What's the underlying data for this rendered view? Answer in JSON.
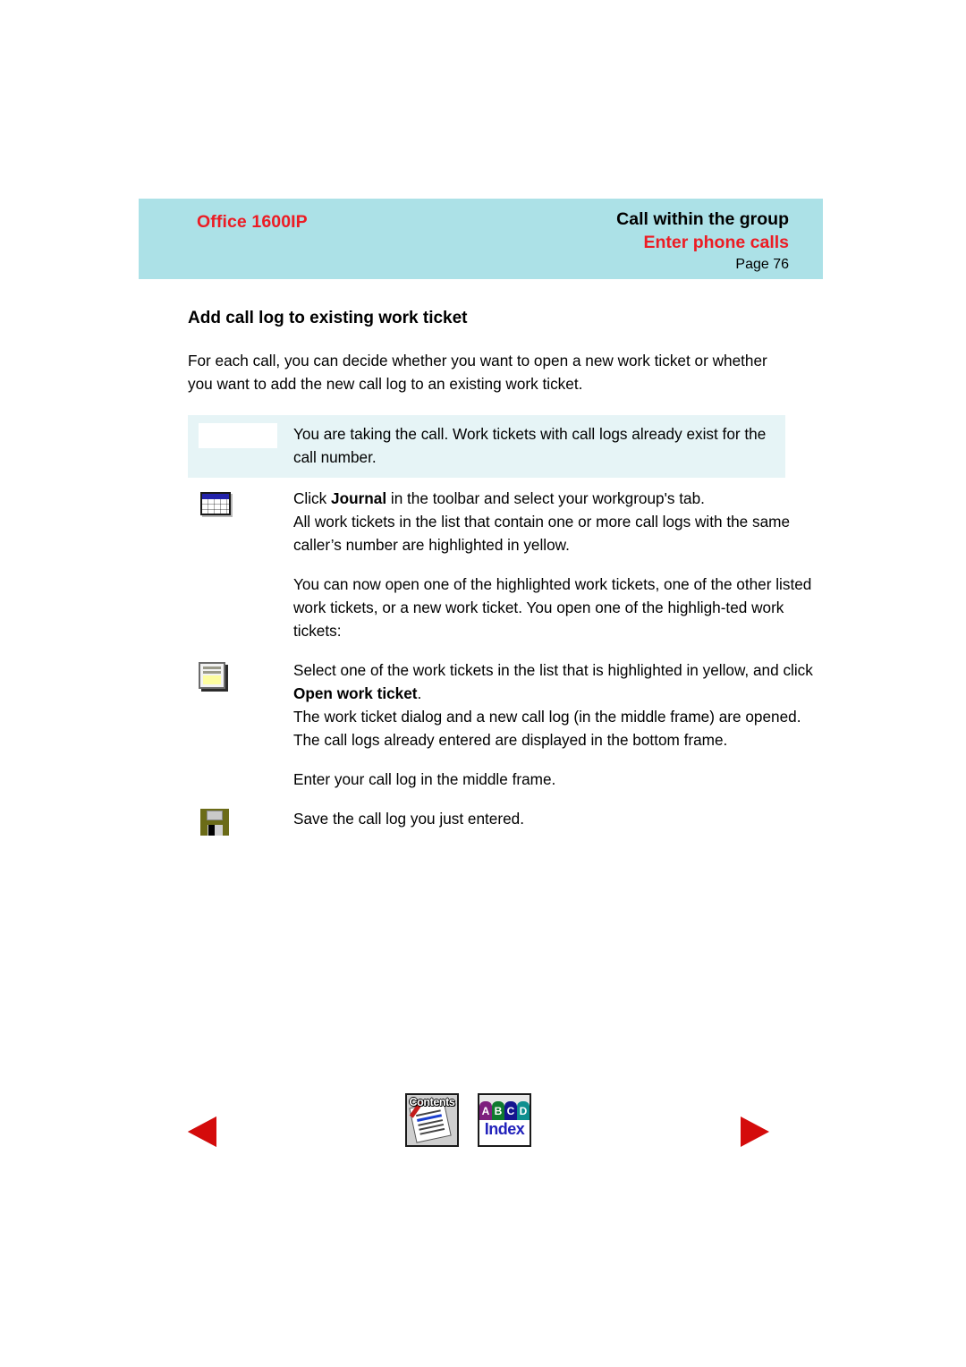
{
  "header": {
    "product": "Office 1600IP",
    "section": "Call within the group",
    "subsection": "Enter phone calls",
    "page_label": "Page 76",
    "band_color": "#ace1e7",
    "accent_color": "#ec1c24"
  },
  "content": {
    "section_title": "Add call log to existing work ticket",
    "intro": "For each call, you can decide whether you want to open a new work ticket or whether you want to add the new call log to an existing work ticket.",
    "note": {
      "text": "You are taking the call. Work tickets with call logs already exist for the call number.",
      "background": "#e6f4f6"
    },
    "steps": [
      {
        "icon": "journal-icon",
        "lines": [
          "Click ",
          "Journal",
          " in the toolbar and select your workgroup's tab."
        ],
        "line_plain": "Click Journal in the toolbar and select your workgroup's tab.",
        "result": "All work tickets in the list that contain one or more call logs with the same caller’s number are highlighted in yellow."
      },
      {
        "icon": "none",
        "paragraph": "You can now open one of the highlighted work tickets, one of the other listed work tickets, or a new work ticket. You open one of the highligh-ted work tickets:"
      },
      {
        "icon": "ticket-icon",
        "lead": "Select one of the work tickets in the list that is highlighted in yellow, and click ",
        "bold": "Open work ticket",
        "tail": ".",
        "result": "The work ticket dialog and a new call log (in the middle frame) are opened. The call logs already entered are displayed in the bottom frame."
      },
      {
        "icon": "none",
        "paragraph": "Enter your call log in the middle frame."
      },
      {
        "icon": "save-icon",
        "paragraph": "Save the call log you just entered."
      }
    ]
  },
  "footer": {
    "prev_label": "Previous page",
    "next_label": "Next page",
    "contents_label": "Contents",
    "index_label": "Index",
    "index_tabs": [
      "A",
      "B",
      "C",
      "D"
    ],
    "arrow_color": "#d40b0b"
  }
}
